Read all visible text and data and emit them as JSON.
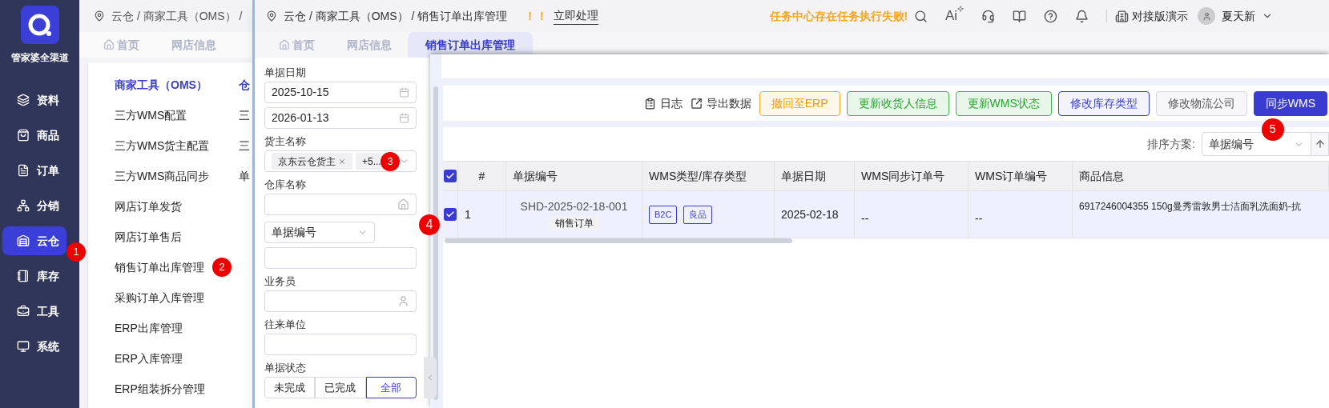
{
  "sidebar": {
    "logo_text": "管家婆全渠道",
    "items": [
      {
        "label": "资料",
        "selected": false
      },
      {
        "label": "商品",
        "selected": false
      },
      {
        "label": "订单",
        "selected": false
      },
      {
        "label": "分销",
        "selected": false
      },
      {
        "label": "云仓",
        "selected": true,
        "badge": "1"
      },
      {
        "label": "库存",
        "selected": false
      },
      {
        "label": "工具",
        "selected": false
      },
      {
        "label": "系统",
        "selected": false
      }
    ]
  },
  "back_window": {
    "breadcrumb": "云仓 / 商家工具（OMS） /",
    "tabs": [
      {
        "label": "首页",
        "kind": "home"
      },
      {
        "label": "网店信息",
        "kind": "page"
      }
    ],
    "menu_columns": [
      {
        "header": "商家工具（OMS）",
        "items": [
          {
            "label": "三方WMS配置"
          },
          {
            "label": "三方WMS货主配置"
          },
          {
            "label": "三方WMS商品同步"
          },
          {
            "label": "网店订单发货"
          },
          {
            "label": "网店订单售后"
          },
          {
            "label": "销售订单出库管理",
            "badge": "2"
          },
          {
            "label": "采购订单入库管理"
          },
          {
            "label": "ERP出库管理"
          },
          {
            "label": "ERP入库管理"
          },
          {
            "label": "ERP组装拆分管理"
          }
        ]
      },
      {
        "header": "仓",
        "items": [
          {
            "label": "三"
          },
          {
            "label": "三"
          },
          {
            "label": "单"
          }
        ]
      }
    ]
  },
  "front_window": {
    "breadcrumb": "云仓 / 商家工具（OMS） / 销售订单出库管理",
    "alert_marks": [
      "!",
      "!"
    ],
    "action_link": "立即处理",
    "task_warning": "任务中心存在任务执行失败!",
    "ai_label": "Ai",
    "company": "对接版演示",
    "user_name": "夏天新",
    "tabs": [
      {
        "label": "首页",
        "kind": "home",
        "selected": false
      },
      {
        "label": "网店信息",
        "kind": "page",
        "selected": false
      },
      {
        "label": "销售订单出库管理",
        "kind": "page",
        "selected": true
      }
    ],
    "filters": [
      {
        "kind": "date_range",
        "label": "单据日期",
        "values": [
          "2025-10-15",
          "2026-01-13"
        ]
      },
      {
        "kind": "tag_select",
        "label": "货主名称",
        "tags": [
          "京东云仓货主"
        ],
        "more": "+5...",
        "badge": "3"
      },
      {
        "kind": "warehouse_input",
        "label": "仓库名称"
      },
      {
        "kind": "select_input",
        "select": "单据编号"
      },
      {
        "kind": "person_input",
        "label": "业务员"
      },
      {
        "kind": "input",
        "label": "往来单位"
      },
      {
        "kind": "segmented",
        "label": "单据状态",
        "options": [
          {
            "label": "未完成",
            "selected": false
          },
          {
            "label": "已完成",
            "selected": false
          },
          {
            "label": "全部",
            "selected": true
          }
        ]
      }
    ]
  },
  "grid_window": {
    "toolbar_links": [
      {
        "label": "日志"
      },
      {
        "label": "导出数据"
      }
    ],
    "buttons": [
      {
        "label": "撤回至ERP",
        "kind": "warning"
      },
      {
        "label": "更新收货人信息",
        "kind": "success"
      },
      {
        "label": "更新WMS状态",
        "kind": "success"
      },
      {
        "label": "修改库存类型",
        "kind": "outline"
      },
      {
        "label": "修改物流公司",
        "kind": "default"
      },
      {
        "label": "同步WMS",
        "kind": "primary",
        "badge": "5"
      }
    ],
    "sort_label": "排序方案:",
    "sort_value": "单据编号",
    "header_checked": true,
    "columns": [
      "#",
      "单据编号",
      "WMS类型/库存类型",
      "单据日期",
      "WMS同步订单号",
      "WMS订单编号",
      "商品信息"
    ],
    "rows": [
      {
        "checked": true,
        "badge": "4",
        "index": "1",
        "doc_no": "SHD-2025-02-18-001",
        "doc_type": "销售订单",
        "tags": [
          "B2C",
          "良品"
        ],
        "date": "2025-02-18",
        "wms_sync_no": "--",
        "wms_order_no": "--",
        "product": "6917246004355 150g曼秀雷敦男士洁面乳洗面奶-抗"
      }
    ]
  }
}
